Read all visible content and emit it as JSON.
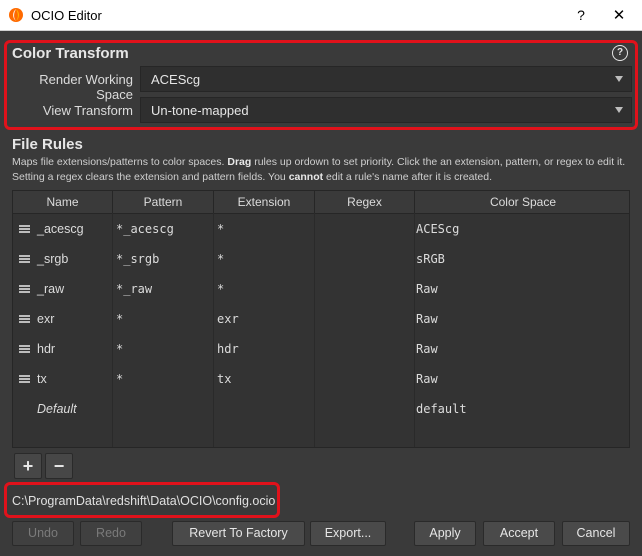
{
  "window": {
    "title": "OCIO Editor",
    "help_glyph": "?",
    "close_glyph": "✕"
  },
  "color_transform": {
    "section_title": "Color Transform",
    "help_label": "?",
    "render_working_space_label": "Render Working Space",
    "render_working_space_value": "ACEScg",
    "view_transform_label": "View Transform",
    "view_transform_value": "Un-tone-mapped"
  },
  "file_rules": {
    "section_title": "File Rules",
    "desc_part1": "Maps file extensions/patterns to color spaces. ",
    "desc_bold1": "Drag",
    "desc_part2": " rules up ordown to set priority. Click the an extension, pattern, or regex to edit it. Setting a regex clears the extension and pattern fields. You ",
    "desc_bold2": "cannot",
    "desc_part3": " edit a rule's name after it is created.",
    "columns": [
      "Name",
      "Pattern",
      "Extension",
      "Regex",
      "Color Space"
    ],
    "rows": [
      {
        "name": "_acescg",
        "pattern": "*_acescg",
        "extension": "*",
        "regex": "",
        "color_space": "ACEScg"
      },
      {
        "name": "_srgb",
        "pattern": "*_srgb",
        "extension": "*",
        "regex": "",
        "color_space": "sRGB"
      },
      {
        "name": "_raw",
        "pattern": "*_raw",
        "extension": "*",
        "regex": "",
        "color_space": "Raw"
      },
      {
        "name": "exr",
        "pattern": "*",
        "extension": "exr",
        "regex": "",
        "color_space": "Raw"
      },
      {
        "name": "hdr",
        "pattern": "*",
        "extension": "hdr",
        "regex": "",
        "color_space": "Raw"
      },
      {
        "name": "tx",
        "pattern": "*",
        "extension": "tx",
        "regex": "",
        "color_space": "Raw"
      }
    ],
    "default_row": {
      "name": "Default",
      "color_space": "default"
    },
    "add_label": "+",
    "remove_label": "−"
  },
  "config_path": "C:\\ProgramData\\redshift\\Data\\OCIO\\config.ocio",
  "buttons": {
    "undo": "Undo",
    "redo": "Redo",
    "revert": "Revert To Factory",
    "export": "Export...",
    "apply": "Apply",
    "accept": "Accept",
    "cancel": "Cancel"
  },
  "colors": {
    "highlight": "#e0121b",
    "background": "#3a3a3a",
    "titlebar": "#ffffff"
  }
}
